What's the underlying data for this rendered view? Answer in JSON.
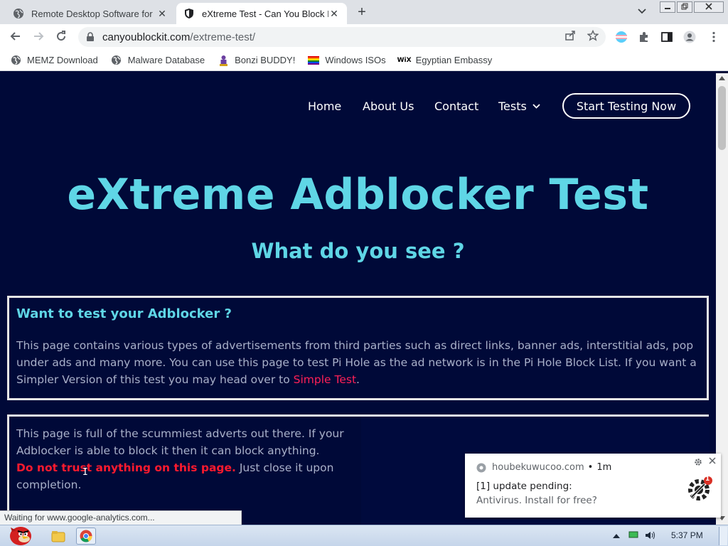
{
  "browser": {
    "tabs": [
      {
        "title": "Remote Desktop Software for",
        "active": false
      },
      {
        "title": "eXtreme Test - Can You Block I",
        "active": true
      }
    ],
    "new_tab_symbol": "+",
    "tab_close_symbol": "✕",
    "url_host": "canyoublockit.com",
    "url_path": "/extreme-test/",
    "bookmarks": [
      {
        "label": "MEMZ Download",
        "icon": "globe-icon"
      },
      {
        "label": "Malware Database",
        "icon": "globe-icon"
      },
      {
        "label": "Bonzi BUDDY!",
        "icon": "bonzi-icon"
      },
      {
        "label": "Windows ISOs",
        "icon": "rainbow-flag-icon"
      },
      {
        "label": "Egyptian Embassy",
        "icon": "wix-icon"
      }
    ],
    "wix_label": "WiX",
    "status_text": "Waiting for www.google-analytics.com..."
  },
  "site": {
    "nav": {
      "home": "Home",
      "about": "About Us",
      "contact": "Contact",
      "tests": "Tests",
      "cta": "Start Testing Now"
    },
    "hero_title": "eXtreme Adblocker Test",
    "hero_subtitle": "What do you see ?",
    "box1": {
      "heading": "Want to test your Adblocker ?",
      "body": "This page contains various types of advertisements from third parties such as direct links, banner ads, interstitial ads, pop under ads and many more. You can use this page to test Pi Hole as the ad network is in the Pi Hole Block List. If you want a Simpler Version of this test you may head over to ",
      "link": "Simple Test",
      "end": "."
    },
    "box2": {
      "body": "This page is full of the scummiest adverts out there. If your Adblocker is able to block it then it can block anything.",
      "warning": "Do not trust anything on this page.",
      "tail": " Just close it upon completion."
    }
  },
  "notification": {
    "source": "houbekuwucoo.com",
    "age": "1m",
    "separator": "•",
    "line1": "[1] update pending:",
    "line2": "Antivirus. Install for free?",
    "badge": "1"
  },
  "taskbar": {
    "clock": "5:37 PM"
  },
  "colors": {
    "page_bg": "#000938",
    "accent_cyan": "#5fd6e6",
    "link_red": "#ff2057",
    "warn_red": "#ff1a2e"
  }
}
